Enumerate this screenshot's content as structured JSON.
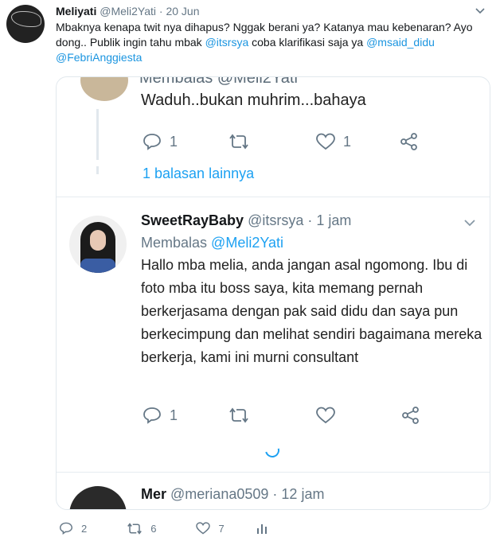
{
  "tweet": {
    "author_name": "Meliyati",
    "author_handle": "@Meli2Yati",
    "separator": "·",
    "date": "20 Jun",
    "text_part1": "Mbaknya kenapa twit nya dihapus? Nggak berani ya? Katanya mau kebenaran? Ayo dong.. Publik ingin tahu mbak ",
    "mention1": "@itsrsya",
    "text_part2": " coba klarifikasi saja ya ",
    "mention2": "@msaid_didu",
    "mention3": "@FebriAnggiesta",
    "avatar_logo_text": "MELI YATI"
  },
  "screenshot": {
    "reply1": {
      "cut_reply_text": "Membalas @Meli2Yati",
      "text": "Waduh..bukan muhrim...bahaya",
      "reply_count": "1",
      "like_count": "1"
    },
    "more_replies": "1 balasan lainnya",
    "reply2": {
      "name": "SweetRayBaby",
      "handle": "@itsrsya",
      "separator": "·",
      "time": "1 jam",
      "reply_prefix": "Membalas",
      "reply_mention": "@Meli2Yati",
      "text": "Hallo mba melia, anda jangan asal ngomong. Ibu di foto mba itu boss saya, kita memang pernah berkerjasama dengan pak said didu dan saya pun berkecimpung dan melihat sendiri bagaimana mereka berkerja, kami ini murni consultant",
      "reply_count": "1"
    },
    "reply3": {
      "name": "Mer",
      "handle": "@meriana0509",
      "separator": "·",
      "time": "12 jam"
    }
  },
  "footer": {
    "reply_count": "2",
    "retweet_count": "6",
    "like_count": "7"
  },
  "colors": {
    "accent": "#1da1f2",
    "muted": "#657786",
    "border": "#e1e8ed"
  }
}
